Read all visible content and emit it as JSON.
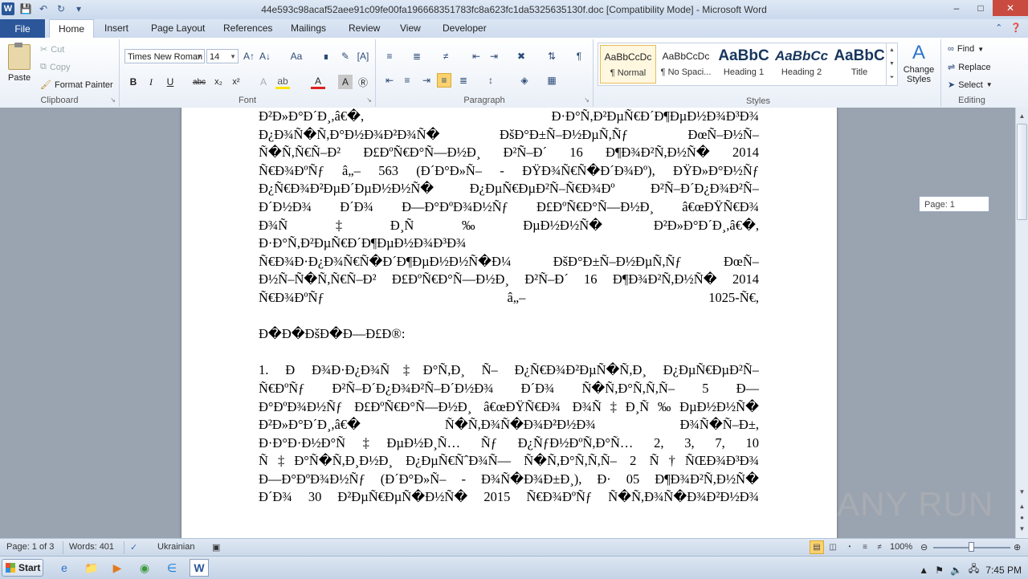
{
  "window": {
    "title": "44e593c98acaf52aee91c09fe00fa196668351783fc8a623fc1da5325635130f.doc [Compatibility Mode]  -  Microsoft Word"
  },
  "tabs": [
    "File",
    "Home",
    "Insert",
    "Page Layout",
    "References",
    "Mailings",
    "Review",
    "View",
    "Developer"
  ],
  "clipboard": {
    "paste": "Paste",
    "cut": "Cut",
    "copy": "Copy",
    "format_painter": "Format Painter",
    "group": "Clipboard"
  },
  "font": {
    "name": "Times New Roman",
    "size": "14",
    "group": "Font"
  },
  "paragraph": {
    "group": "Paragraph"
  },
  "styles": {
    "group": "Styles",
    "items": [
      {
        "preview": "AaBbCcDc",
        "name": "¶ Normal"
      },
      {
        "preview": "AaBbCcDc",
        "name": "¶ No Spaci..."
      },
      {
        "preview": "AaBbC",
        "name": "Heading 1"
      },
      {
        "preview": "AaBbCc",
        "name": "Heading 2"
      },
      {
        "preview": "AaBbC",
        "name": "Title"
      }
    ],
    "change_styles": "Change Styles"
  },
  "editing": {
    "find": "Find",
    "replace": "Replace",
    "select": "Select",
    "group": "Editing"
  },
  "document": {
    "lines": [
      "Ð²Ð»Ð°Ð´Ð¸,â€�,                             Ð·Ð°Ñ,Ð²ÐµÑ€Ð´Ð¶ÐµÐ½Ð¾Ð³Ð¾",
      "Ð¿Ð¾Ñ�Ñ,Ð°Ð½Ð¾Ð²Ð¾Ñ�          ÐšÐ°Ð±Ñ–Ð½ÐµÑ,Ñƒ       ÐœÑ–Ð½Ñ–",
      "Ñ�Ñ,Ñ€Ñ–Ð²  Ð£ÐºÑ€Ð°Ñ—Ð½Ð¸  Ð²Ñ–Ð´  16  Ð¶Ð¾Ð²Ñ,Ð½Ñ�  2014",
      "Ñ€Ð¾ÐºÑƒ  â„–  563  (Ð´Ð°Ð»Ñ–  -  ÐŸÐ¾Ñ€Ñ�Ð´Ð¾Ðº),  ÐŸÐ»Ð°Ð½Ñƒ",
      "Ð¿Ñ€Ð¾Ð²ÐµÐ´ÐµÐ½Ð½Ñ�  Ð¿ÐµÑ€ÐµÐ²Ñ–Ñ€Ð¾Ðº  Ð²Ñ–Ð´Ð¿Ð¾Ð²Ñ–",
      "Ð´Ð½Ð¾  Ð´Ð¾  Ð—Ð°ÐºÐ¾Ð½Ñƒ  Ð£ÐºÑ€Ð°Ñ—Ð½Ð¸  â€œÐŸÑ€Ð¾",
      "Ð¾Ñ‡Ð¸Ñ‰ÐµÐ½Ð½Ñ�                                  Ð²Ð»Ð°Ð´Ð¸,â€�,",
      "Ð·Ð°Ñ,Ð²ÐµÑ€Ð´Ð¶ÐµÐ½Ð¾Ð³Ð¾",
      "Ñ€Ð¾Ð·Ð¿Ð¾Ñ€Ñ�Ð´Ð¶ÐµÐ½Ð½Ñ�Ð¼  ÐšÐ°Ð±Ñ–Ð½ÐµÑ,Ñƒ  ÐœÑ–",
      "Ð½Ñ–Ñ�Ñ,Ñ€Ñ–Ð²  Ð£ÐºÑ€Ð°Ñ—Ð½Ð¸  Ð²Ñ–Ð´  16  Ð¶Ð¾Ð²Ñ,Ð½Ñ�  2014",
      "Ñ€Ð¾ÐºÑƒ  â„–  1025-Ñ€,",
      "",
      "Ð�Ð�ÐšÐ�Ð—Ð£Ð®:",
      "",
      "1.  Ð Ð¾Ð·Ð¿Ð¾Ñ‡Ð°Ñ,Ð¸  Ñ–  Ð¿Ñ€Ð¾Ð²ÐµÑ�Ñ,Ð¸  Ð¿ÐµÑ€ÐµÐ²Ñ–",
      "Ñ€ÐºÑƒ  Ð²Ñ–Ð´Ð¿Ð¾Ð²Ñ–Ð´Ð½Ð¾  Ð´Ð¾  Ñ�Ñ,Ð°Ñ,Ñ,Ñ–  5  Ð—",
      "Ð°ÐºÐ¾Ð½Ñƒ Ð£ÐºÑ€Ð°Ñ—Ð½Ð¸ â€œÐŸÑ€Ð¾ Ð¾Ñ‡Ð¸Ñ‰ÐµÐ½Ð½Ñ�",
      "Ð²Ð»Ð°Ð´Ð¸,â€�              Ñ�Ñ,Ð¾Ñ�Ð¾Ð²Ð½Ð¾          Ð¾Ñ�Ñ–Ð±,",
      "Ð·Ð°Ð·Ð½Ð°Ñ‡ÐµÐ½Ð¸Ñ…    Ñƒ    Ð¿ÑƒÐ½ÐºÑ,Ð°Ñ…    2,  3,  7,  10",
      "Ñ‡Ð°Ñ�Ñ,Ð¸Ð½Ð¸  Ð¿ÐµÑ€ÑˆÐ¾Ñ—  Ñ�Ñ,Ð°Ñ,Ñ,Ñ–  2  Ñ†ÑŒÐ¾Ð³Ð¾",
      "Ð—Ð°ÐºÐ¾Ð½Ñƒ  (Ð´Ð°Ð»Ñ–  -  Ð¾Ñ�Ð¾Ð±Ð¸),  Ð·  05  Ð¶Ð¾Ð²Ñ,Ð½Ñ�",
      "Ð´Ð¾  30  Ð²ÐµÑ€ÐµÑ�Ð½Ñ�  2015  Ñ€Ð¾ÐºÑƒ  Ñ�Ñ,Ð¾Ñ�Ð¾Ð²Ð½Ð¾"
    ],
    "page_tip": "Page: 1"
  },
  "status": {
    "page": "Page: 1 of 3",
    "words": "Words: 401",
    "language": "Ukrainian",
    "zoom": "100%"
  },
  "taskbar": {
    "start": "Start",
    "time": "7:45 PM"
  },
  "watermark": "ANY RUN"
}
